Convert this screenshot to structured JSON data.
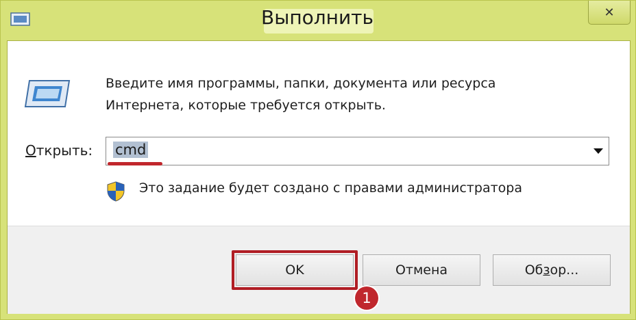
{
  "window": {
    "title": "Выполнить",
    "close_glyph": "✕"
  },
  "dialog": {
    "description_line1": "Введите имя программы, папки, документа или ресурса",
    "description_line2": "Интернета, которые требуется открыть.",
    "open_label_accel": "О",
    "open_label_rest": "ткрыть:",
    "open_value": "cmd",
    "admin_note": "Это задание будет создано с правами администратора"
  },
  "buttons": {
    "ok": "OK",
    "cancel": "Отмена",
    "browse_pre": "Об",
    "browse_accel": "з",
    "browse_post": "ор..."
  },
  "annotation": {
    "step_number": "1",
    "highlight_color": "#c1272d"
  },
  "icons": {
    "app": "run-app-icon",
    "run": "run-dialog-icon",
    "shield": "uac-shield-icon",
    "dropdown": "dropdown-arrow-icon"
  },
  "colors": {
    "title_bar": "#d7e279",
    "highlight": "#b01d24",
    "selection": "#b2c0d2"
  }
}
